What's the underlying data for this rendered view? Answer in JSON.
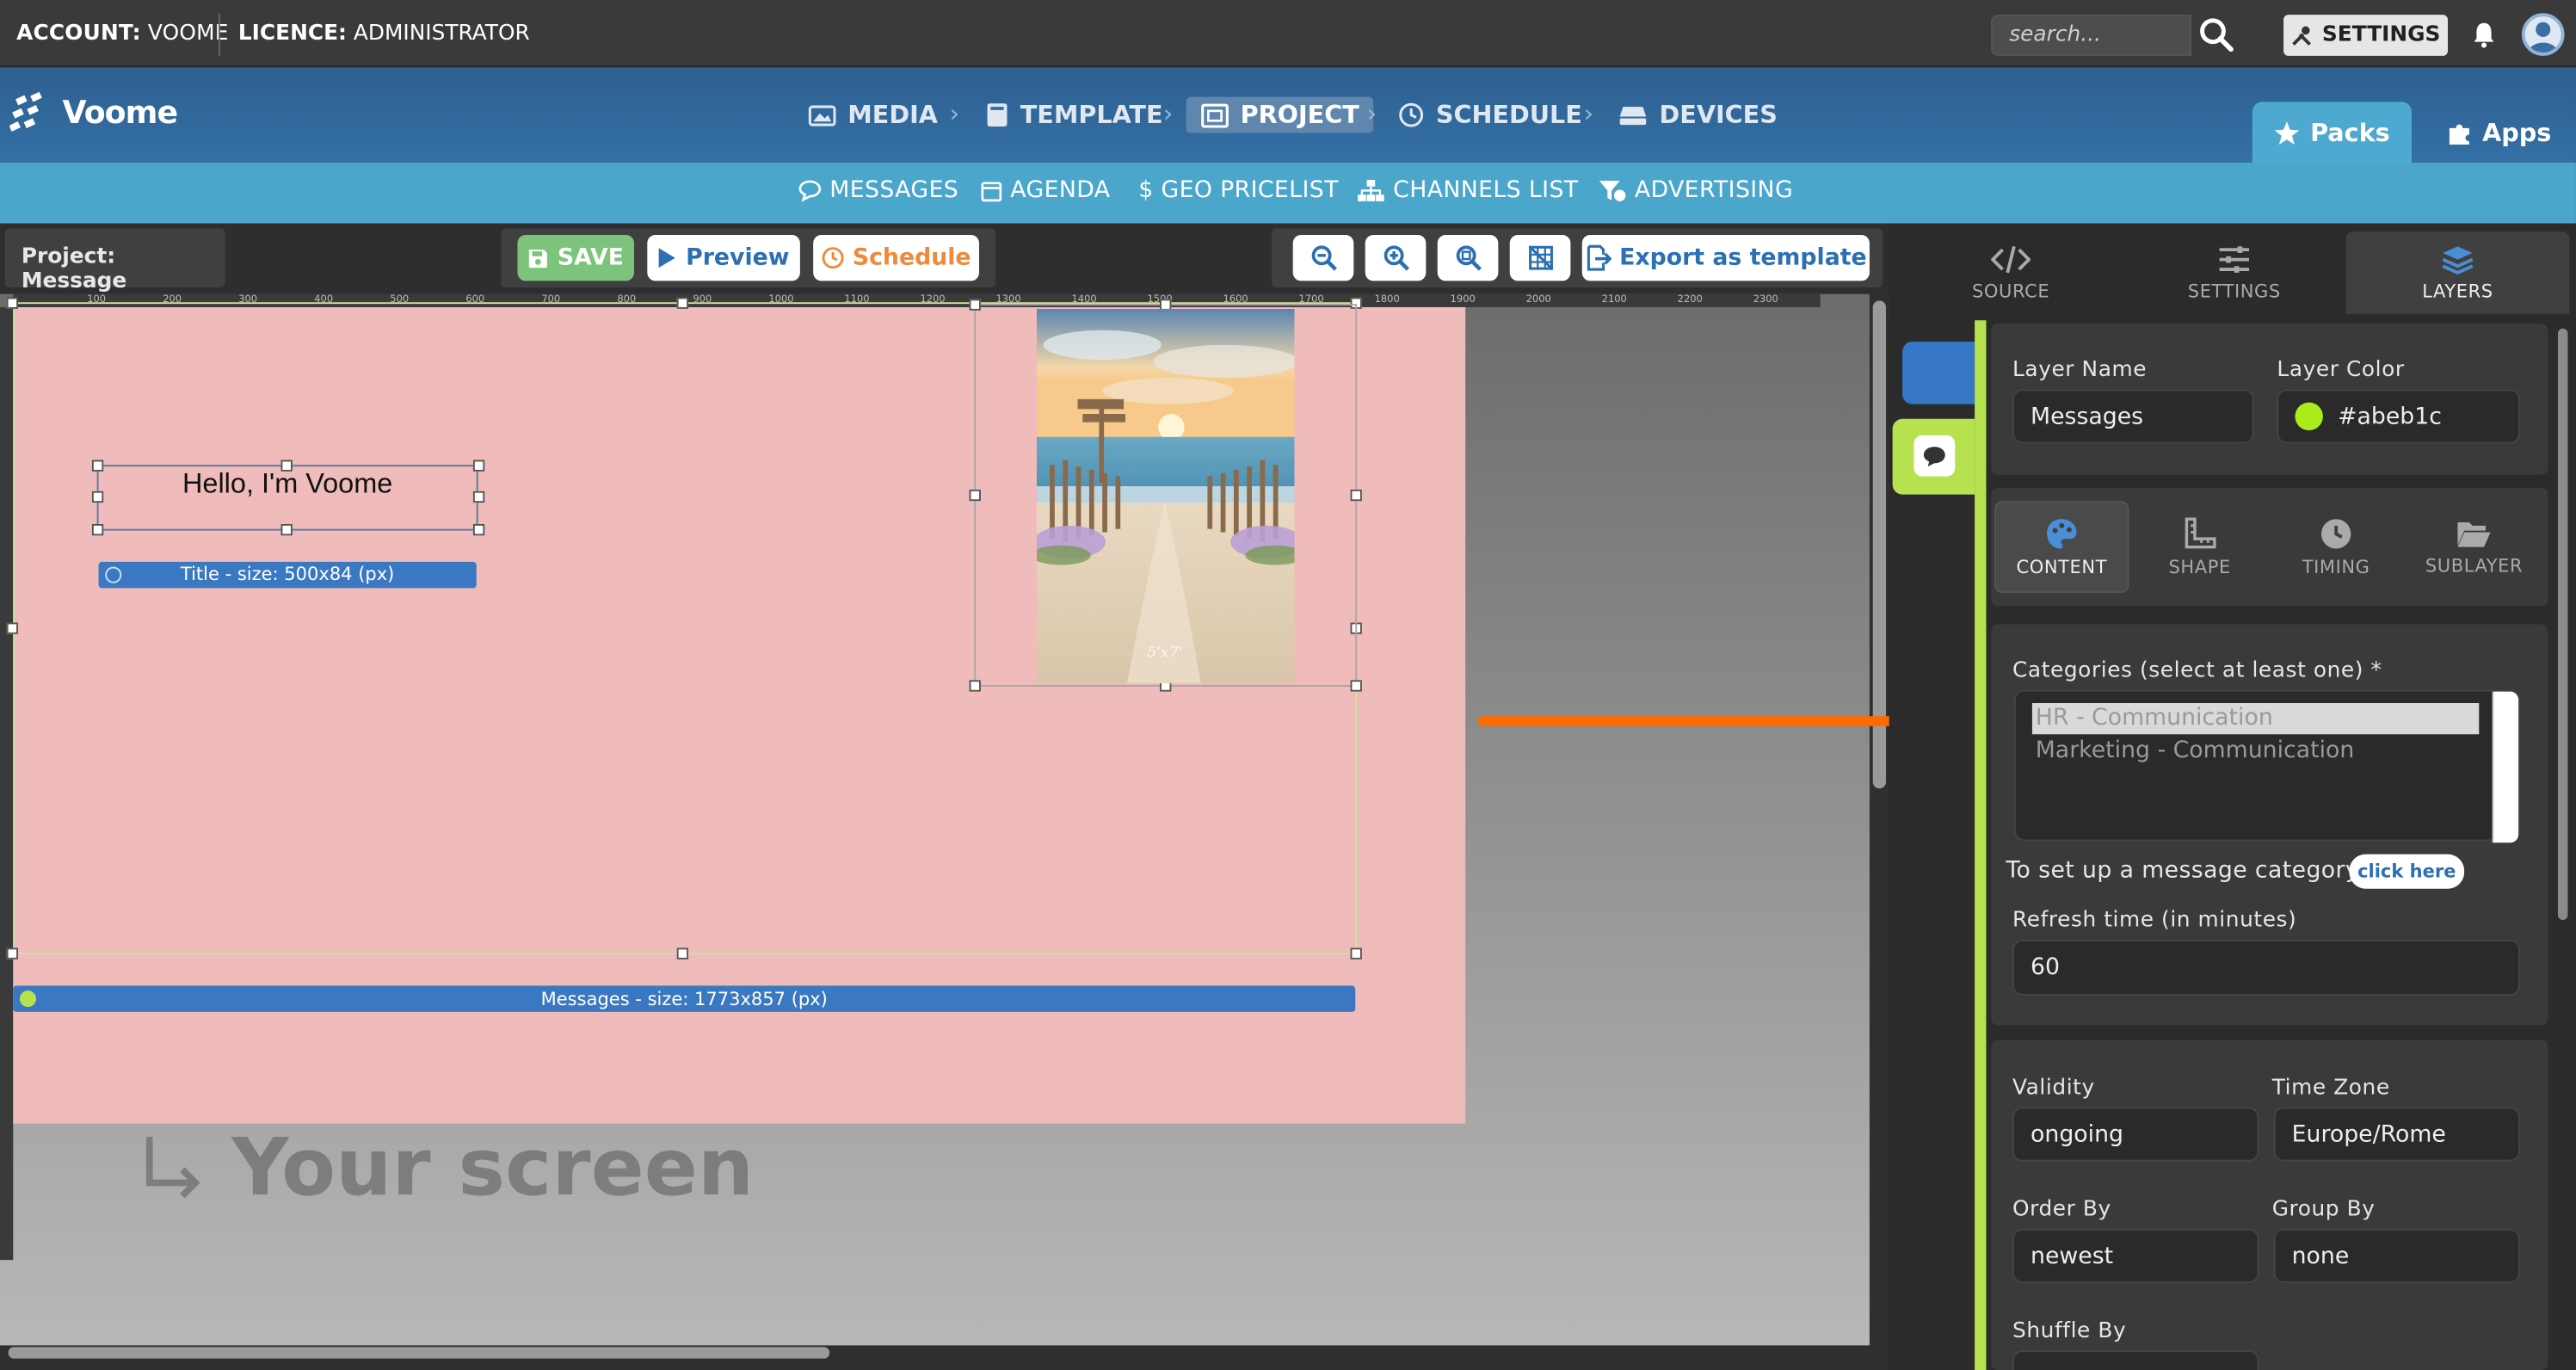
{
  "topbar": {
    "account_label": "ACCOUNT:",
    "account_value": "VOOME",
    "licence_label": "LICENCE:",
    "licence_value": "ADMINISTRATOR",
    "search_placeholder": "search...",
    "settings_label": "SETTINGS"
  },
  "brand": {
    "name": "Voome"
  },
  "nav": {
    "items": [
      {
        "label": "MEDIA"
      },
      {
        "label": "TEMPLATE"
      },
      {
        "label": "PROJECT",
        "active": true
      },
      {
        "label": "SCHEDULE"
      },
      {
        "label": "DEVICES"
      }
    ],
    "packs": "Packs",
    "apps": "Apps"
  },
  "subnav": {
    "items": [
      "MESSAGES",
      "AGENDA",
      "$ GEO PRICELIST",
      "CHANNELS LIST",
      "ADVERTISING"
    ]
  },
  "editor": {
    "project_title": "Project: Message",
    "save": "SAVE",
    "preview": "Preview",
    "schedule": "Schedule",
    "export": "Export as template",
    "ruler_ticks": [
      "100",
      "200",
      "300",
      "400",
      "500",
      "600",
      "700",
      "800",
      "900",
      "1000",
      "1100",
      "1200",
      "1300",
      "1400",
      "1500",
      "1600",
      "1700",
      "1800",
      "1900",
      "2000",
      "2100",
      "2200",
      "2300"
    ]
  },
  "canvas": {
    "title_text": "Hello, I'm Voome",
    "title_label": "Title - size: 500x84 (px)",
    "messages_label": "Messages - size: 1773x857 (px)",
    "screen_caption": "Your screen",
    "image_caption": "5'x7'"
  },
  "right_panel": {
    "tabs": [
      {
        "label": "SOURCE"
      },
      {
        "label": "SETTINGS"
      },
      {
        "label": "LAYERS",
        "active": true
      }
    ],
    "layer_name_label": "Layer Name",
    "layer_name_value": "Messages",
    "layer_color_label": "Layer Color",
    "layer_color_value": "#abeb1c",
    "subtabs": [
      {
        "label": "CONTENT",
        "active": true
      },
      {
        "label": "SHAPE"
      },
      {
        "label": "TIMING"
      },
      {
        "label": "SUBLAYER"
      }
    ],
    "categories_label": "Categories (select at least one) *",
    "categories": [
      "HR - Communication",
      "Marketing - Communication"
    ],
    "setup_text": "To set up a message category:",
    "click_here": "click here",
    "refresh_label": "Refresh time (in minutes)",
    "refresh_value": "60",
    "validity_label": "Validity",
    "validity_value": "ongoing",
    "timezone_label": "Time Zone",
    "timezone_value": "Europe/Rome",
    "orderby_label": "Order By",
    "orderby_value": "newest",
    "groupby_label": "Group By",
    "groupby_value": "none",
    "shuffle_label": "Shuffle By"
  },
  "colors": {
    "accent_blue": "#3577c4",
    "layer_green": "#b6e24f",
    "screen_pink": "#efbbbb",
    "arrow_orange": "#ff6a00"
  }
}
